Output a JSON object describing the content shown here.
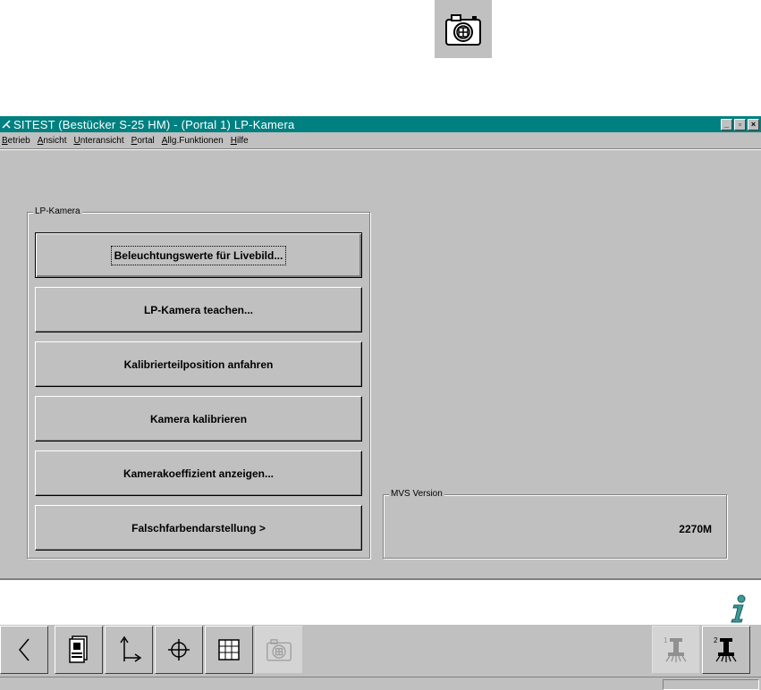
{
  "window": {
    "title": "SITEST (Bestücker S-25 HM) - (Portal 1) LP-Kamera",
    "minimize_label": "_",
    "maximize_label": "▫",
    "close_label": "×"
  },
  "menu": {
    "items": [
      "Betrieb",
      "Ansicht",
      "Unteransicht",
      "Portal",
      "Allg.Funktionen",
      "Hilfe"
    ]
  },
  "camera_group": {
    "label": "LP-Kamera",
    "buttons": [
      "Beleuchtungswerte für Livebild...",
      "LP-Kamera teachen...",
      "Kalibrierteilposition anfahren",
      "Kamera kalibrieren",
      "Kamerakoeffizient anzeigen...",
      "Falschfarbendarstellung >"
    ]
  },
  "mvs_group": {
    "label": "MVS Version",
    "value": "2270M"
  },
  "icons": {
    "top_camera": "camera-icon",
    "info": "info-icon",
    "toolbar": [
      "back-arrow-icon",
      "station-icon",
      "axes-icon",
      "crosshair-icon",
      "grid-icon",
      "camera-icon",
      "placement-head-1-icon",
      "placement-head-2-icon"
    ]
  },
  "colors": {
    "titlebar": "#008080",
    "face": "#c0c0c0",
    "info_accent": "#3a9a9a"
  }
}
